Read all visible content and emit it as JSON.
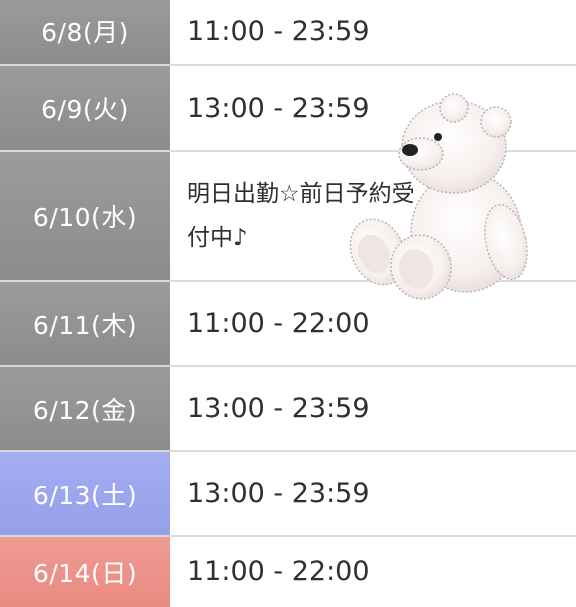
{
  "schedule": {
    "rows": [
      {
        "date": "6/8(月)",
        "time": "11:00 - 23:59",
        "day_type": "weekday"
      },
      {
        "date": "6/9(火)",
        "time": "13:00 - 23:59",
        "day_type": "weekday"
      },
      {
        "date": "6/10(水)",
        "time": "明日出勤☆前日予約受付中♪",
        "day_type": "weekday"
      },
      {
        "date": "6/11(木)",
        "time": "11:00 - 22:00",
        "day_type": "weekday"
      },
      {
        "date": "6/12(金)",
        "time": "13:00 - 23:59",
        "day_type": "weekday"
      },
      {
        "date": "6/13(土)",
        "time": "13:00 - 23:59",
        "day_type": "saturday"
      },
      {
        "date": "6/14(日)",
        "time": "11:00 - 22:00",
        "day_type": "sunday"
      }
    ]
  },
  "colors": {
    "weekday": "#939393",
    "saturday": "#9da7ee",
    "sunday": "#ec928a",
    "divider": "#dcdcdc",
    "text": "#2f2f2f"
  },
  "icons": {
    "bear": "teddy-bear-icon"
  }
}
